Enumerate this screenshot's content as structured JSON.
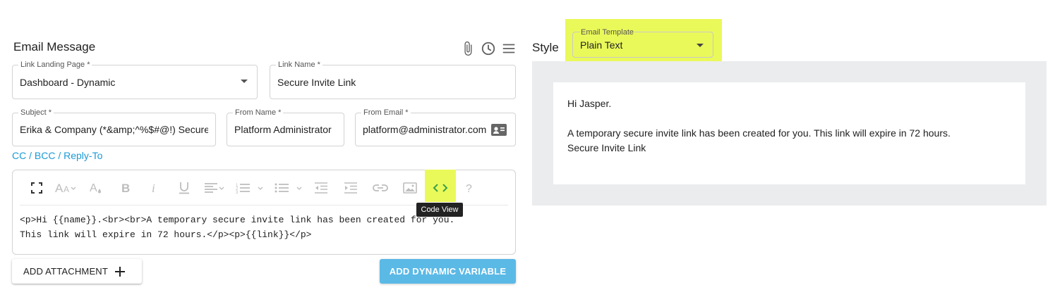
{
  "email_message": {
    "title": "Email Message",
    "header_icons": [
      "paperclip-icon",
      "clock-icon",
      "menu-icon"
    ]
  },
  "fields": {
    "link_landing_page": {
      "label": "Link Landing Page *",
      "value": "Dashboard - Dynamic"
    },
    "link_name": {
      "label": "Link Name *",
      "value": "Secure Invite Link"
    },
    "subject": {
      "label": "Subject *",
      "value": "Erika & Company (*&amp;^%$#@!) Secure I"
    },
    "from_name": {
      "label": "From Name *",
      "value": "Platform Administrator"
    },
    "from_email": {
      "label": "From Email *",
      "value": "platform@administrator.com"
    }
  },
  "cc_bcc_link": "CC / BCC / Reply-To",
  "editor": {
    "toolbar_icons": [
      "fullscreen-icon",
      "font-size-icon",
      "font-color-icon",
      "bold-icon",
      "italic-icon",
      "underline-icon",
      "align-icon",
      "ordered-list-icon",
      "unordered-list-icon",
      "outdent-icon",
      "indent-icon",
      "link-icon",
      "image-icon",
      "code-view-icon",
      "help-icon"
    ],
    "tooltip": "Code View",
    "code_line_1": "<p>Hi {{name}}.<br><br>A temporary secure invite link has been created for you.",
    "code_line_2": "This link will expire in 72 hours.</p><p>{{link}}</p>",
    "highlight_color": "#eaf95a"
  },
  "buttons": {
    "add_attachment": "ADD ATTACHMENT",
    "add_dynamic_variable": "ADD DYNAMIC VARIABLE"
  },
  "style": {
    "title": "Style",
    "email_template_label": "Email Template",
    "email_template_value": "Plain Text"
  },
  "preview": {
    "greeting": "Hi Jasper.",
    "body": "A temporary secure invite link has been created for you. This link will expire in 72 hours.",
    "link_text": "Secure Invite Link"
  },
  "colors": {
    "accent_link": "#1a9bd7",
    "primary_button": "#5bb9e6",
    "highlight": "#eaf95a"
  }
}
